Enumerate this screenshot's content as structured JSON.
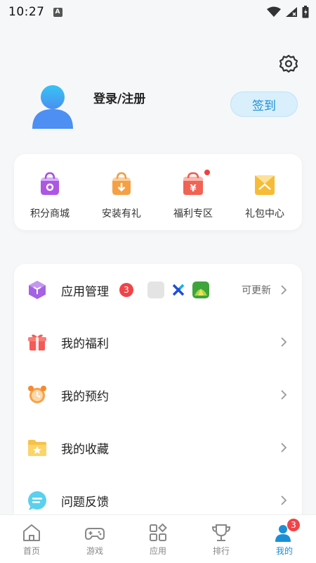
{
  "status_bar": {
    "time": "10:27",
    "notif_letter": "A"
  },
  "header": {
    "login_label": "登录/注册",
    "checkin_label": "签到"
  },
  "quick_actions": [
    {
      "label": "积分商城",
      "icon": "shopping-bag-icon",
      "color": "#b44be3"
    },
    {
      "label": "安装有礼",
      "icon": "download-bag-icon",
      "color": "#f39a3d"
    },
    {
      "label": "福利专区",
      "icon": "yuan-gift-icon",
      "color": "#f05a4a",
      "dot": true
    },
    {
      "label": "礼包中心",
      "icon": "gift-pack-icon",
      "color": "#f5b82e"
    }
  ],
  "menu": {
    "app_manage": {
      "label": "应用管理",
      "badge": "3",
      "update_text": "可更新"
    },
    "welfare": {
      "label": "我的福利"
    },
    "reservation": {
      "label": "我的预约"
    },
    "favorites": {
      "label": "我的收藏"
    },
    "feedback": {
      "label": "问题反馈"
    }
  },
  "bottom_nav": [
    {
      "label": "首页",
      "icon": "home-icon"
    },
    {
      "label": "游戏",
      "icon": "gamepad-icon"
    },
    {
      "label": "应用",
      "icon": "apps-icon"
    },
    {
      "label": "排行",
      "icon": "trophy-icon"
    },
    {
      "label": "我的",
      "icon": "profile-icon",
      "badge": "3",
      "active": true
    }
  ],
  "colors": {
    "accent": "#1b8fd6",
    "badge": "#f04448",
    "background": "#f6f7f9"
  }
}
